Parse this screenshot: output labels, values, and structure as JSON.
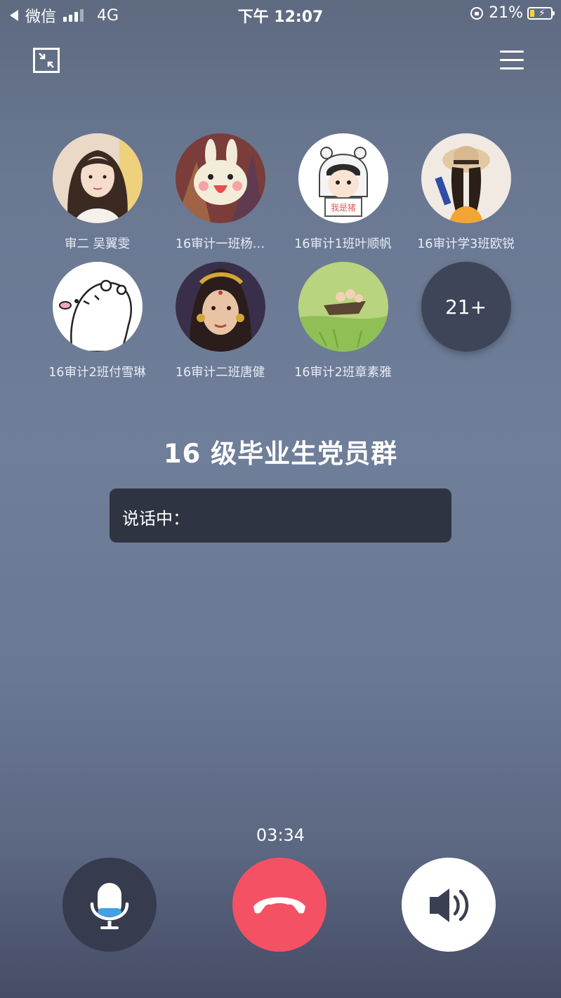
{
  "status_bar": {
    "back_app": "微信",
    "network": "4G",
    "time": "下午 12:07",
    "battery": "21%",
    "battery_level": 0.21
  },
  "icons": {
    "minimize": "minimize-window-icon",
    "menu": "menu-icon",
    "mic": "microphone-icon",
    "hangup": "hang-up-icon",
    "speaker": "speaker-icon"
  },
  "participants": [
    {
      "name": "审二 吴翼雯"
    },
    {
      "name": "16审计一班杨…"
    },
    {
      "name": "16审计1班叶顺帆"
    },
    {
      "name": "16审计学3班欧锐"
    },
    {
      "name": "16审计2班付雪琳"
    },
    {
      "name": "16审计二班唐健"
    },
    {
      "name": "16审计2班章素雅"
    }
  ],
  "more_count": "21+",
  "group": {
    "title": "16 级毕业生党员群",
    "speaking_label": "说话中："
  },
  "call": {
    "duration": "03:34"
  },
  "colors": {
    "hangup": "#f55164",
    "mic_bg": "#363c4d",
    "speaker_bg": "#ffffff",
    "speaking_box": "#2f3442"
  }
}
